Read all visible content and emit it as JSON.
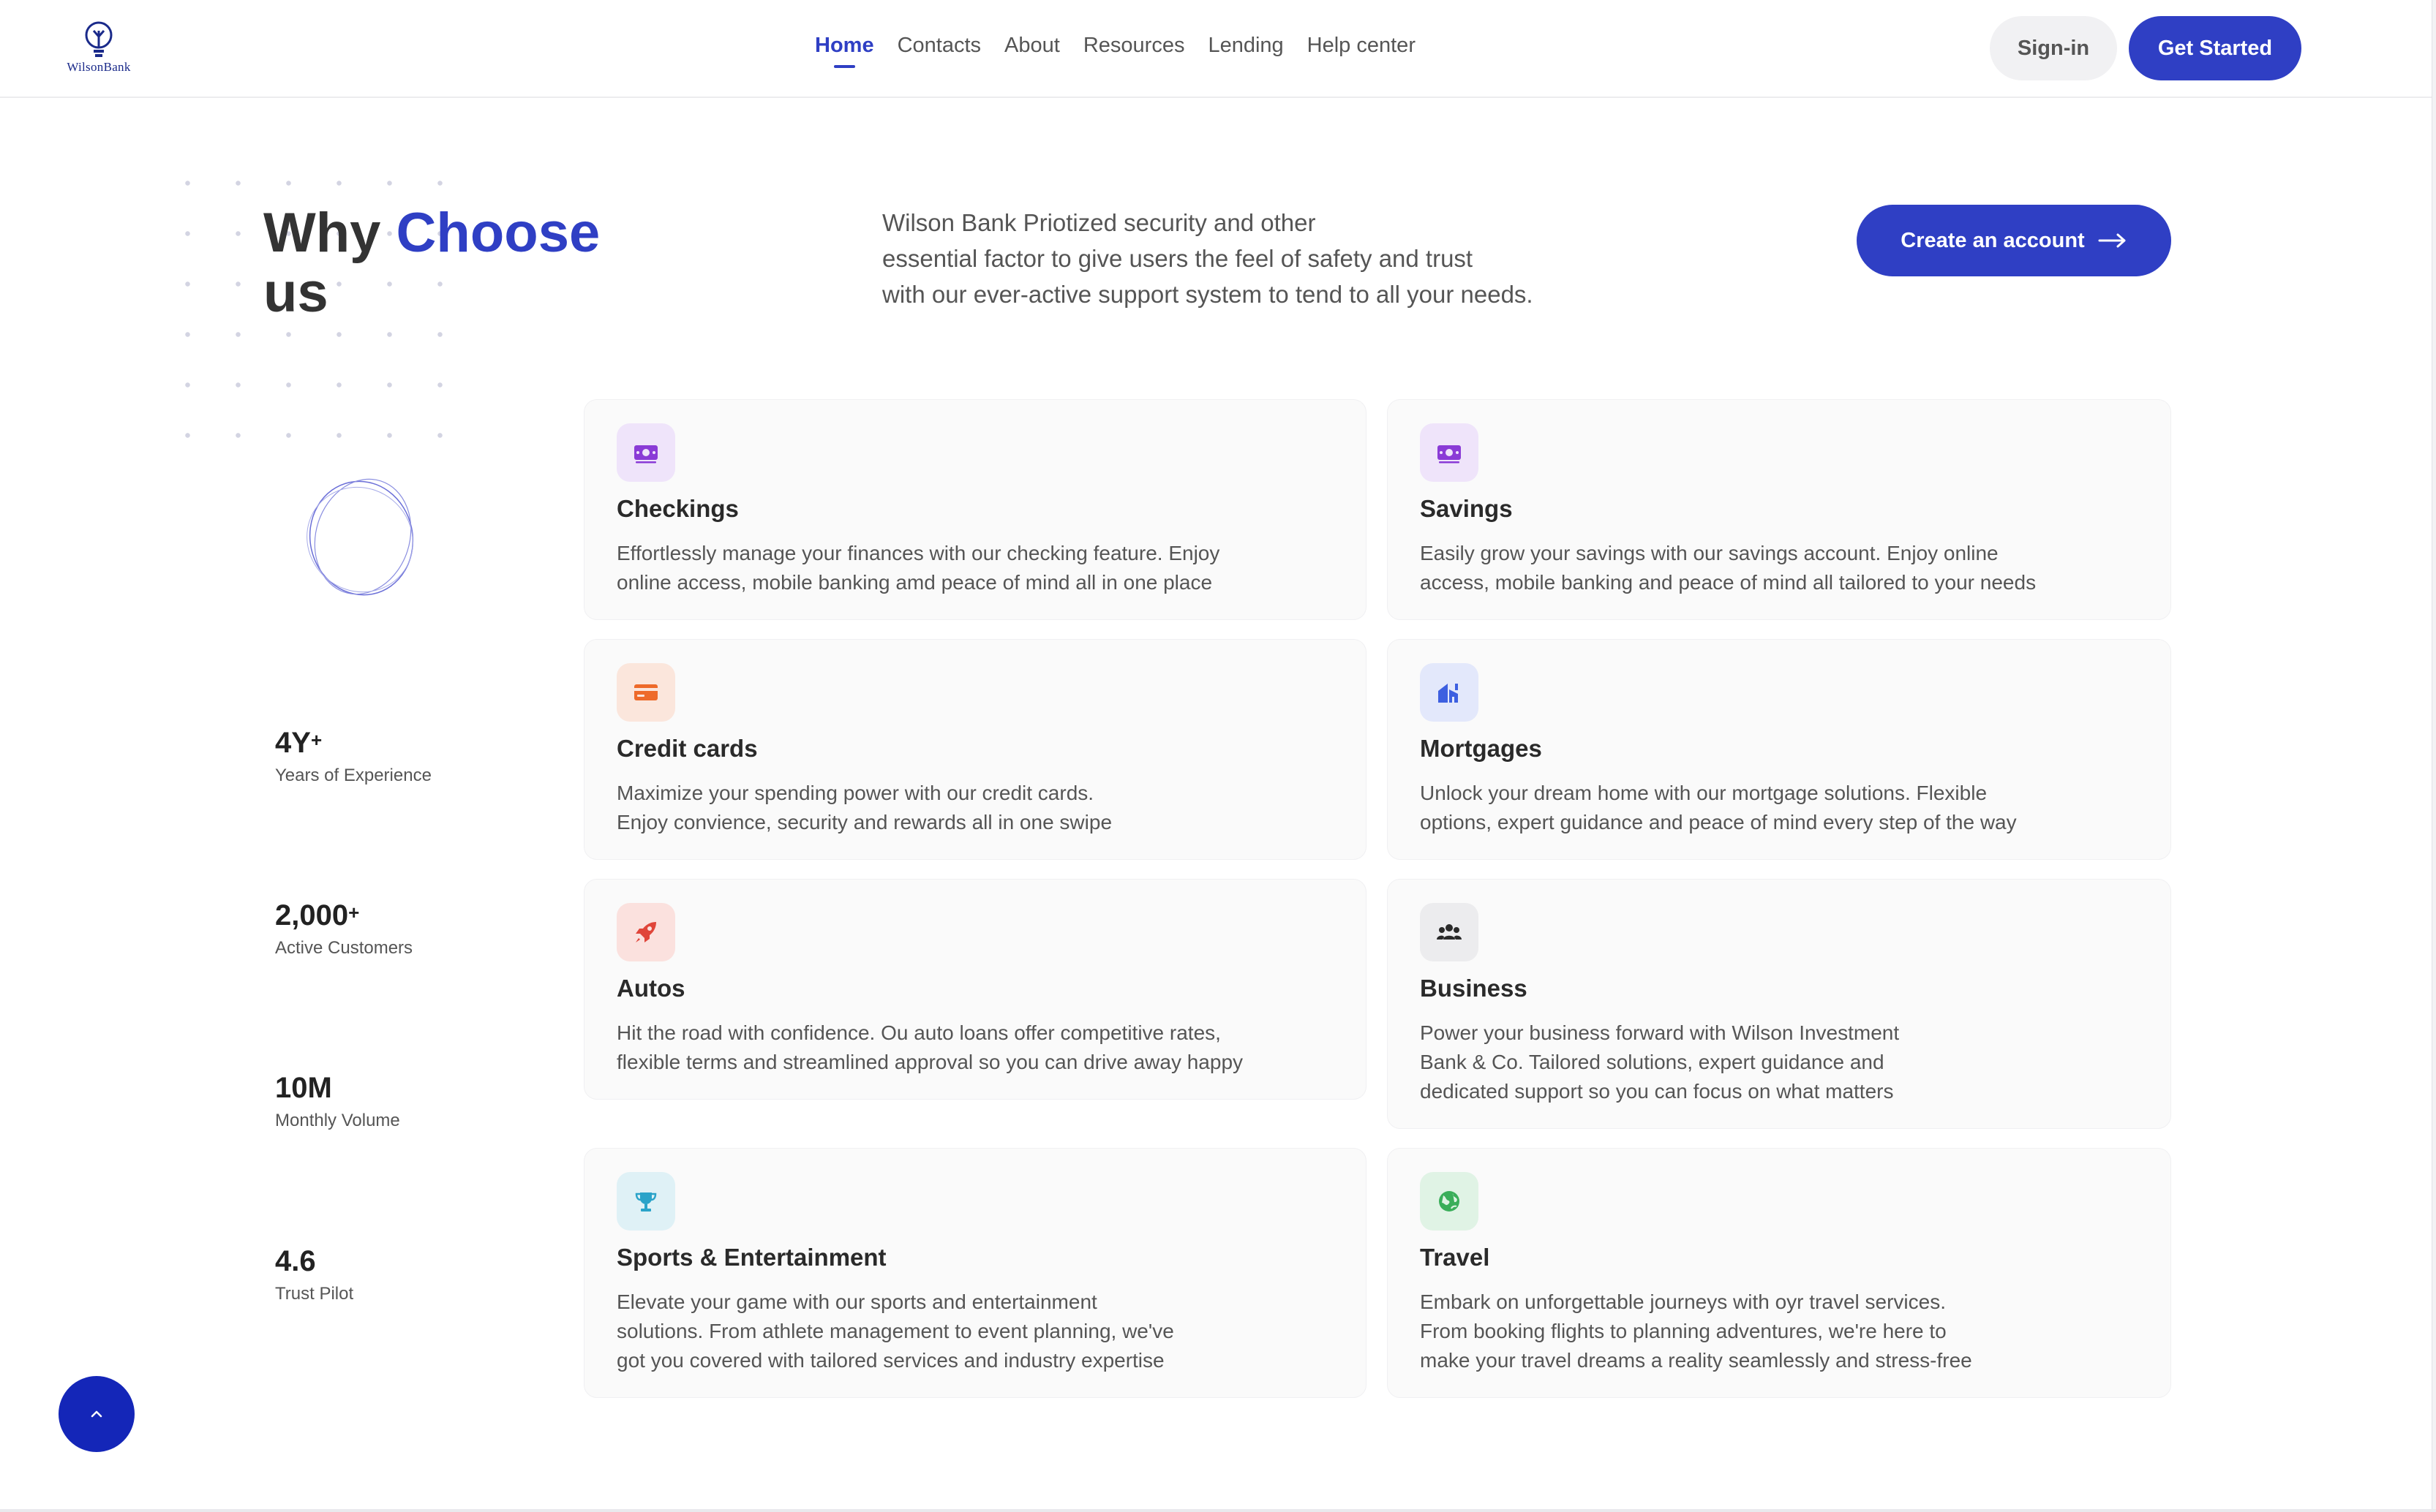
{
  "brand": {
    "name": "WilsonBank",
    "accent": "#2f3fc4"
  },
  "nav": {
    "items": [
      {
        "label": "Home",
        "active": true
      },
      {
        "label": "Contacts"
      },
      {
        "label": "About"
      },
      {
        "label": "Resources"
      },
      {
        "label": "Lending"
      },
      {
        "label": "Help center"
      }
    ]
  },
  "header": {
    "signin_label": "Sign-in",
    "get_started_label": "Get Started"
  },
  "hero": {
    "title_part1": "Why ",
    "title_accent": "Choose",
    "title_part2": "us",
    "intro_lines": [
      "Wilson Bank Priotized security and other",
      "essential factor to give users the feel of safety and trust",
      "with our ever-active support system to tend to all your needs."
    ],
    "cta_label": "Create an account",
    "cta_icon": "arrow-right-icon"
  },
  "stats": [
    {
      "value": "4Y",
      "suffix": "+",
      "label": "Years of Experience"
    },
    {
      "value": "2,000",
      "suffix": "+",
      "label": "Active Customers"
    },
    {
      "value": "10M",
      "suffix": "",
      "label": "Monthly Volume"
    },
    {
      "value": "4.6",
      "suffix": "",
      "label": "Trust Pilot"
    }
  ],
  "cards": [
    {
      "title": "Checkings",
      "icon": "money-icon",
      "icon_color": "#8a3bd6",
      "icon_bg": "#efe4fa",
      "desc": [
        "Effortlessly manage your finances with our checking feature. Enjoy",
        "online access, mobile banking amd peace of mind all in one place"
      ]
    },
    {
      "title": "Savings",
      "icon": "money-icon",
      "icon_color": "#8a3bd6",
      "icon_bg": "#efe4fa",
      "desc": [
        "Easily grow your savings with our savings account. Enjoy online",
        "access, mobile banking and peace of mind all tailored to your needs"
      ]
    },
    {
      "title": "Credit cards",
      "icon": "credit-card-icon",
      "icon_color": "#ee6a2a",
      "icon_bg": "#fbe6dc",
      "desc": [
        "Maximize your spending power with our credit cards.",
        "Enjoy convience, security and rewards all in one swipe"
      ]
    },
    {
      "title": "Mortgages",
      "icon": "house-icon",
      "icon_color": "#3d5fe0",
      "icon_bg": "#e3e8fb",
      "desc": [
        "Unlock your dream home with our mortgage solutions. Flexible",
        "options, expert guidance and peace of mind every step of the way"
      ]
    },
    {
      "title": "Autos",
      "icon": "rocket-icon",
      "icon_color": "#e0453a",
      "icon_bg": "#fbe1de",
      "desc": [
        "Hit the road with confidence. Ou auto loans offer competitive rates,",
        "flexible terms and streamlined approval so you can drive away happy"
      ]
    },
    {
      "title": "Business",
      "icon": "users-icon",
      "icon_color": "#2a2a2a",
      "icon_bg": "#ececee",
      "desc": [
        "Power your business forward with Wilson Investment",
        "Bank & Co. Tailored solutions, expert guidance and",
        "dedicated support so you can focus on what matters"
      ]
    },
    {
      "title": "Sports & Entertainment",
      "icon": "trophy-icon",
      "icon_color": "#2aa3c9",
      "icon_bg": "#dff1f6",
      "desc": [
        "Elevate your game with our sports and entertainment",
        "solutions. From athlete management to event planning, we've",
        "got you covered with tailored services and industry expertise"
      ]
    },
    {
      "title": "Travel",
      "icon": "globe-icon",
      "icon_color": "#3aae5a",
      "icon_bg": "#e0f3e5",
      "desc": [
        "Embark on unforgettable journeys with oyr travel services.",
        "From booking flights to planning adventures, we're here to",
        "make your travel dreams a reality seamlessly and stress-free"
      ]
    }
  ],
  "back_to_top": {
    "icon": "chevron-up-icon"
  }
}
